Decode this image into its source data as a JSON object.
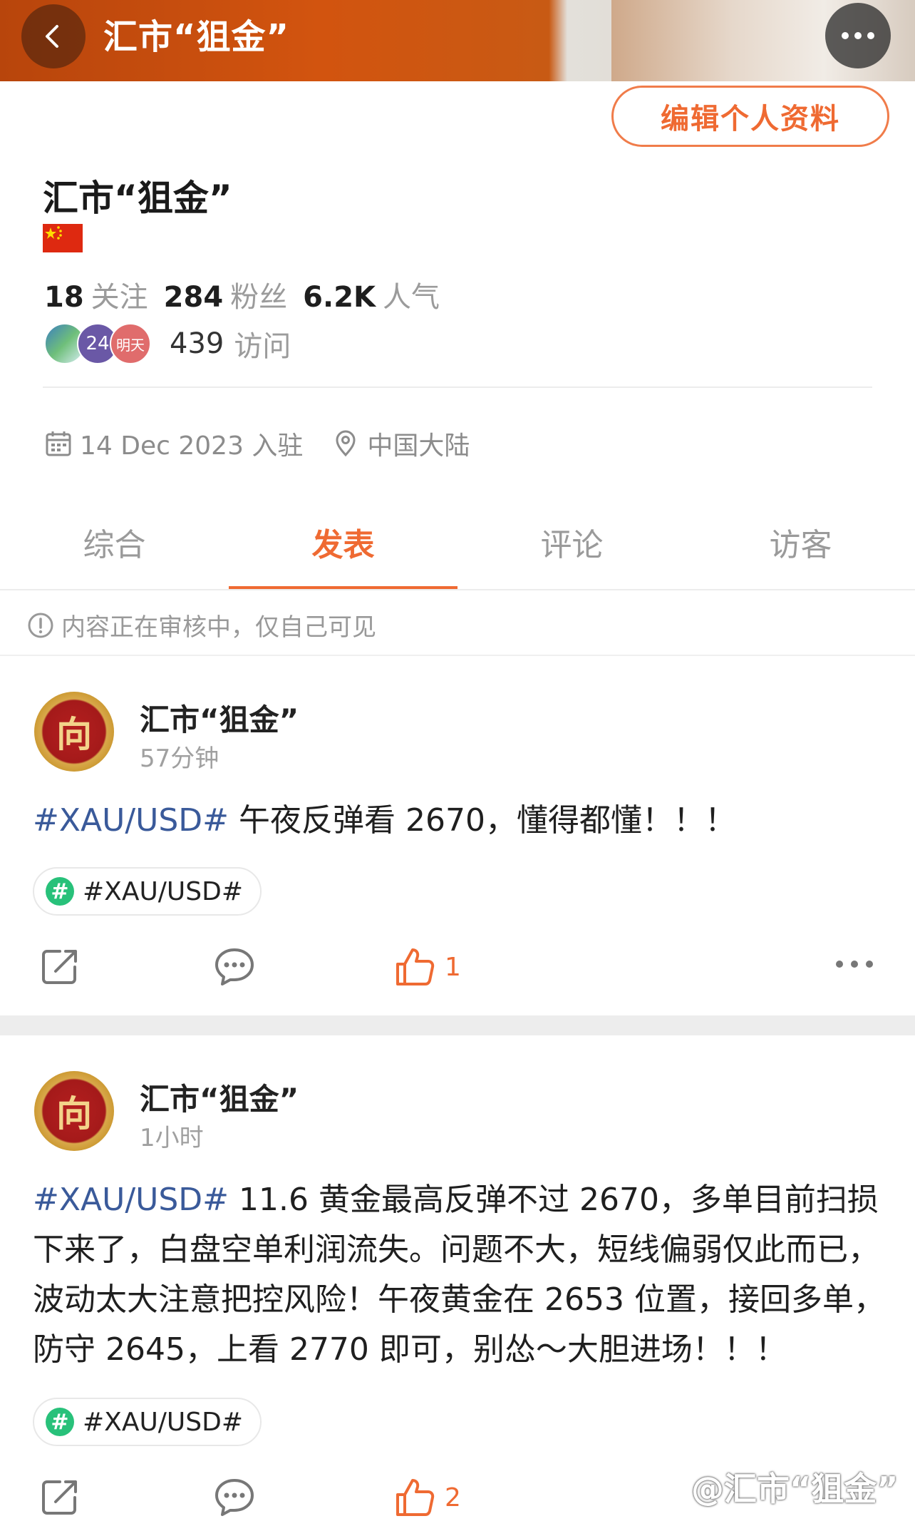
{
  "header": {
    "title": "汇市“狙金”"
  },
  "profile": {
    "edit_label": "编辑个人资料",
    "name": "汇市“狙金”",
    "stats": [
      {
        "num": "18",
        "label": "关注"
      },
      {
        "num": "284",
        "label": "粉丝"
      },
      {
        "num": "6.2K",
        "label": "人气"
      }
    ],
    "visitor_badges": [
      "24",
      "明天"
    ],
    "visit_count": "439",
    "visit_label": "访问",
    "joined": "14 Dec 2023 入驻",
    "location": "中国大陆"
  },
  "tabs": [
    "综合",
    "发表",
    "评论",
    "访客"
  ],
  "active_tab": "发表",
  "notice": "内容正在审核中，仅自己可见",
  "posts": [
    {
      "avatar_text": "向",
      "author": "汇市“狙金”",
      "time": "57分钟",
      "hashtag": "#XAU/USD#",
      "text": " 午夜反弹看 2670，懂得都懂！！！",
      "chip": "#XAU/USD#",
      "likes": "1"
    },
    {
      "avatar_text": "向",
      "author": "汇市“狙金”",
      "time": "1小时",
      "hashtag": "#XAU/USD#",
      "text": " 11.6 黄金最高反弹不过 2670，多单目前扫损下来了，白盘空单利润流失。问题不大，短线偏弱仅此而已，波动太大注意把控风险！午夜黄金在 2653 位置，接回多单，防守 2645，上看 2770 即可，别怂～大胆进场！！！",
      "chip": "#XAU/USD#",
      "likes": "2"
    }
  ],
  "watermark": "@汇市“狙金”",
  "colors": {
    "accent": "#ef6a32",
    "hashtag": "#3a5a9a",
    "topic_green": "#28c17a"
  }
}
